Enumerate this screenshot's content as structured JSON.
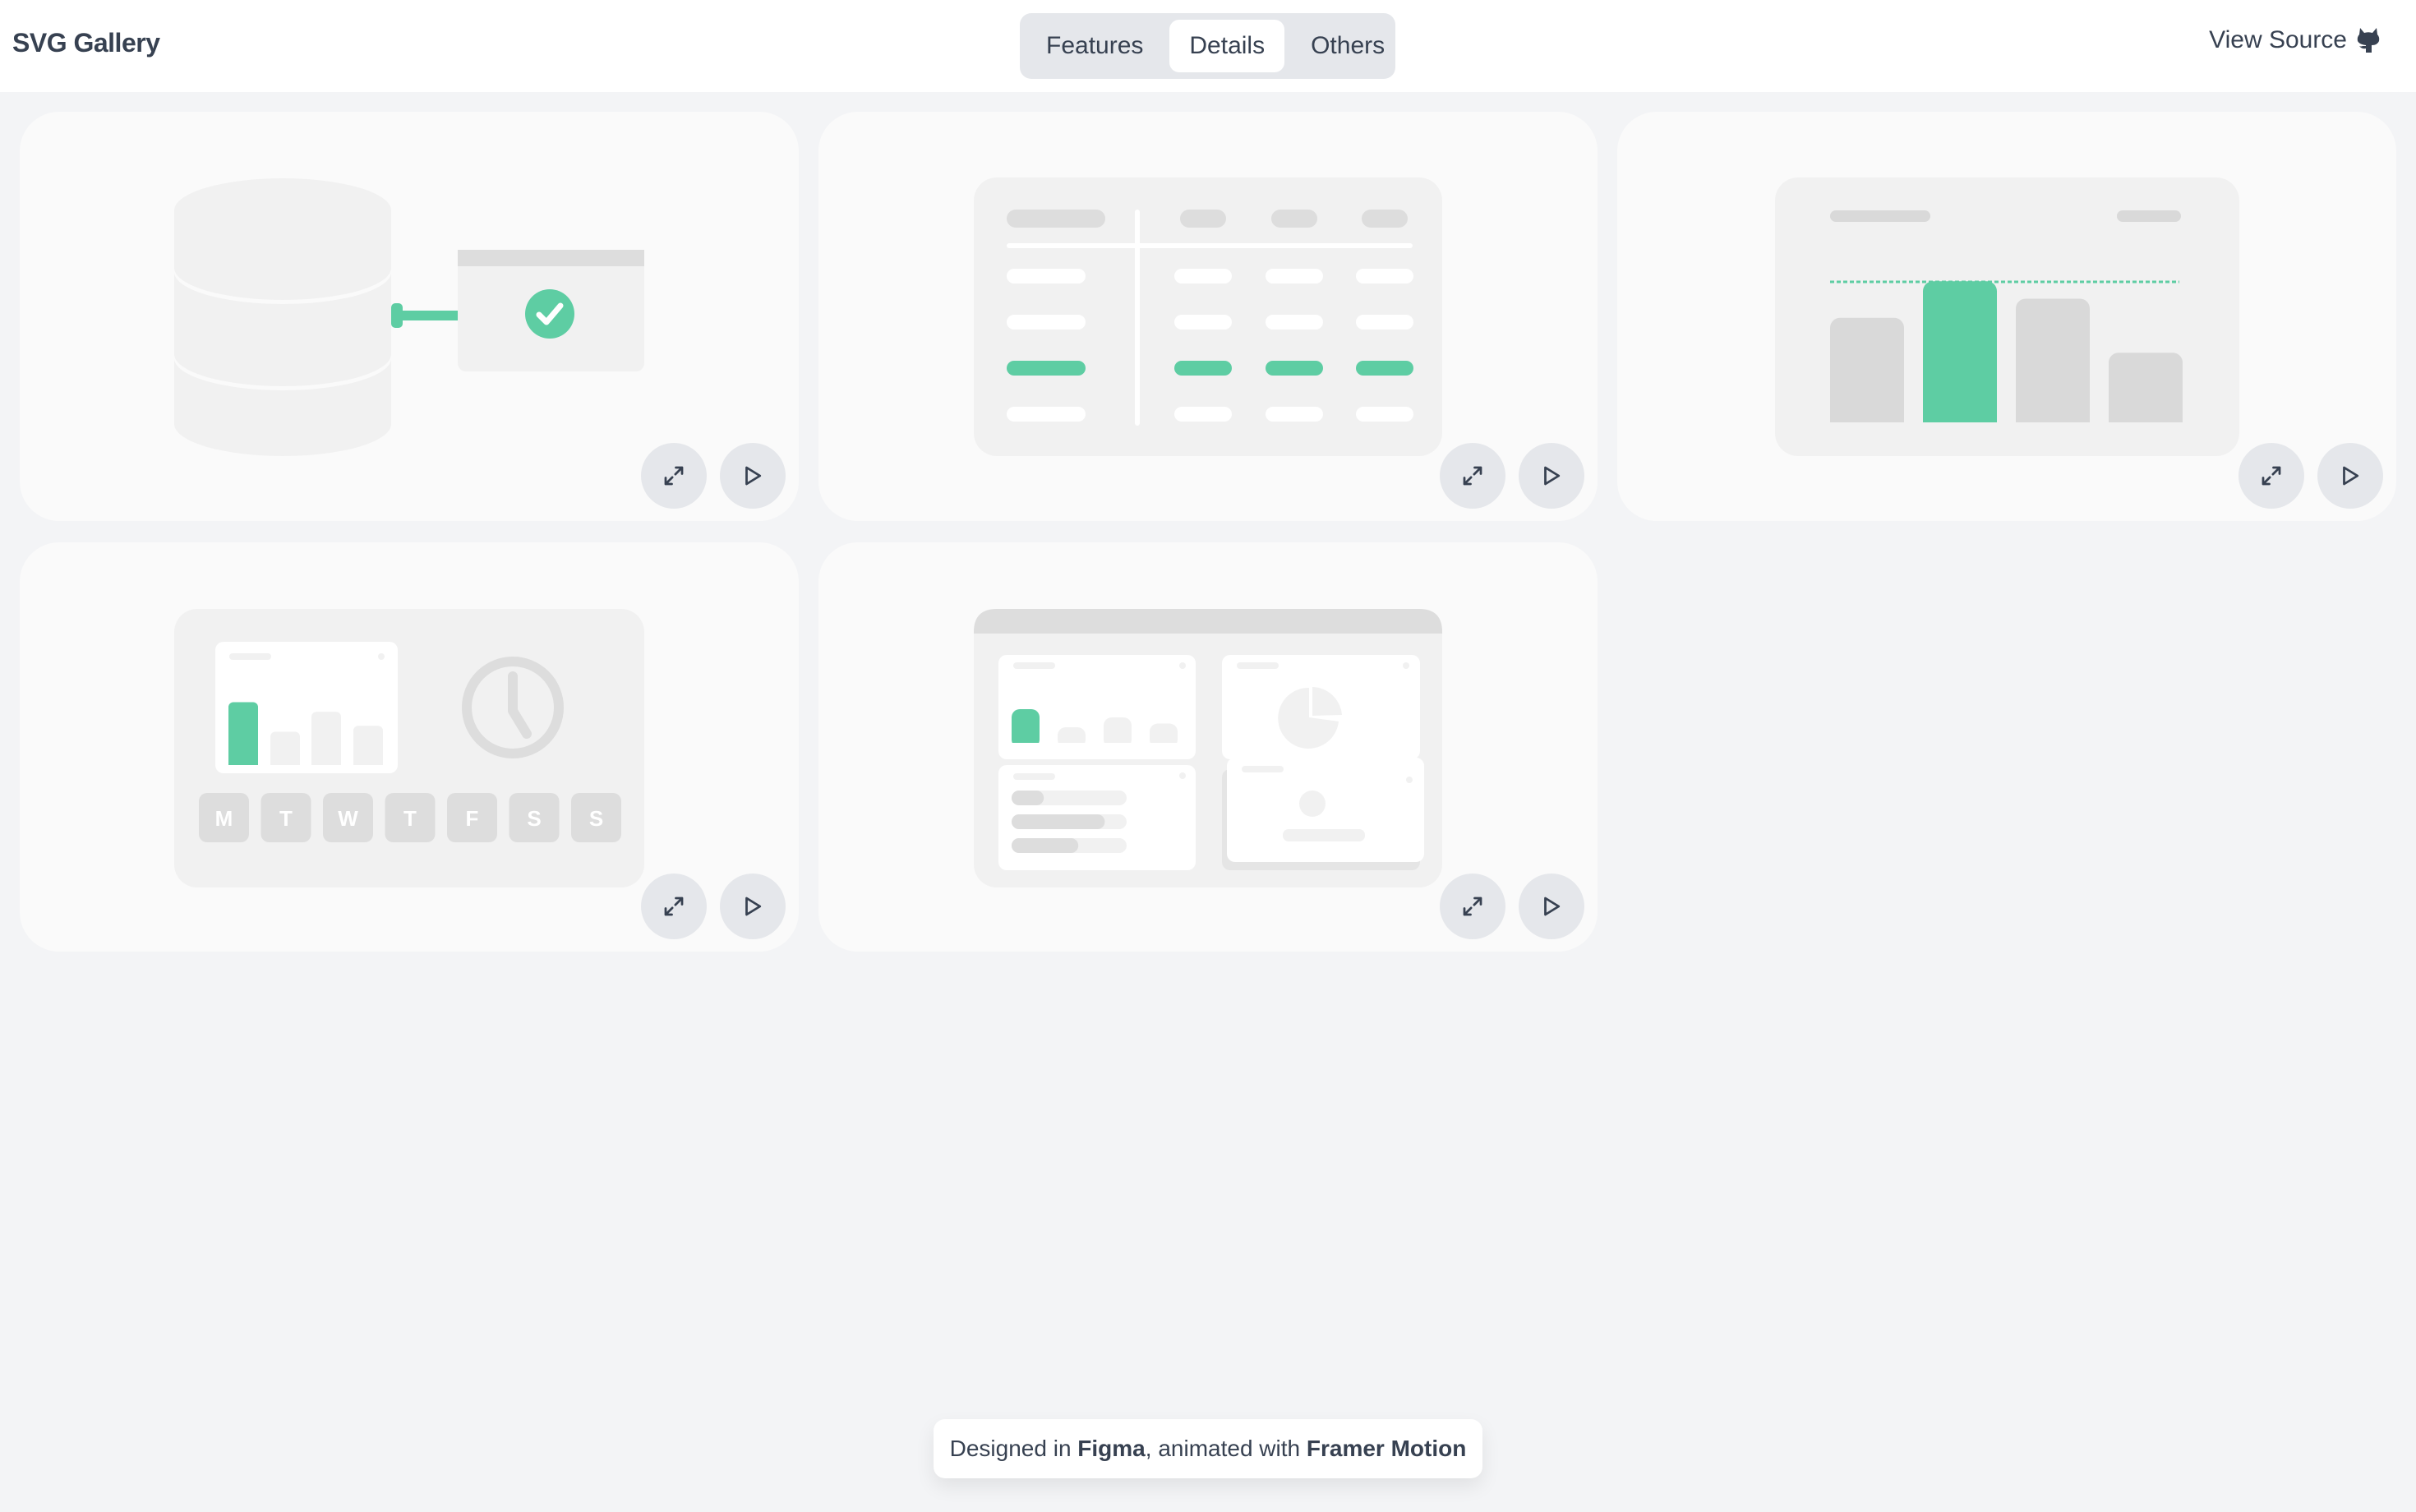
{
  "header": {
    "title": "SVG Gallery",
    "tabs": [
      {
        "label": "Features",
        "active": false
      },
      {
        "label": "Details",
        "active": true
      },
      {
        "label": "Others",
        "active": false
      }
    ],
    "view_source_label": "View Source",
    "view_source_icon": "github-icon"
  },
  "colors": {
    "accent": "#5ecda3",
    "page_bg": "#f3f4f6",
    "card_bg": "#fafafa",
    "illustration_bg": "#f1f1f1",
    "placeholder": "#dddddd",
    "button_bg": "#e5e7eb",
    "text": "#374151"
  },
  "cards": [
    {
      "id": "database-sync",
      "illustration": "database-connected-window-check",
      "buttons": {
        "expand_icon": "expand-icon",
        "play_icon": "play-icon"
      }
    },
    {
      "id": "table-highlight",
      "illustration": "table-with-highlighted-row",
      "highlighted_row": 3,
      "buttons": {
        "expand_icon": "expand-icon",
        "play_icon": "play-icon"
      }
    },
    {
      "id": "bar-threshold",
      "illustration": "bar-chart-with-threshold",
      "bar_values": [
        0.6,
        0.81,
        0.71,
        0.4
      ],
      "highlighted_bar": 2,
      "buttons": {
        "expand_icon": "expand-icon",
        "play_icon": "play-icon"
      }
    },
    {
      "id": "weekly-schedule",
      "illustration": "bar-chart-clock-weekdays",
      "weekdays": [
        "M",
        "T",
        "W",
        "T",
        "F",
        "S",
        "S"
      ],
      "bar_values": [
        0.85,
        0.45,
        0.72,
        0.53
      ],
      "buttons": {
        "expand_icon": "expand-icon",
        "play_icon": "play-icon"
      }
    },
    {
      "id": "dashboard",
      "illustration": "dashboard-widgets",
      "progress_values": [
        0.28,
        0.81,
        0.58
      ],
      "bar_values": [
        0.82,
        0.38,
        0.62,
        0.47
      ],
      "buttons": {
        "expand_icon": "expand-icon",
        "play_icon": "play-icon"
      }
    }
  ],
  "footer": {
    "prefix": "Designed in ",
    "tool1": "Figma",
    "middle": ", animated with ",
    "tool2": "Framer Motion"
  }
}
